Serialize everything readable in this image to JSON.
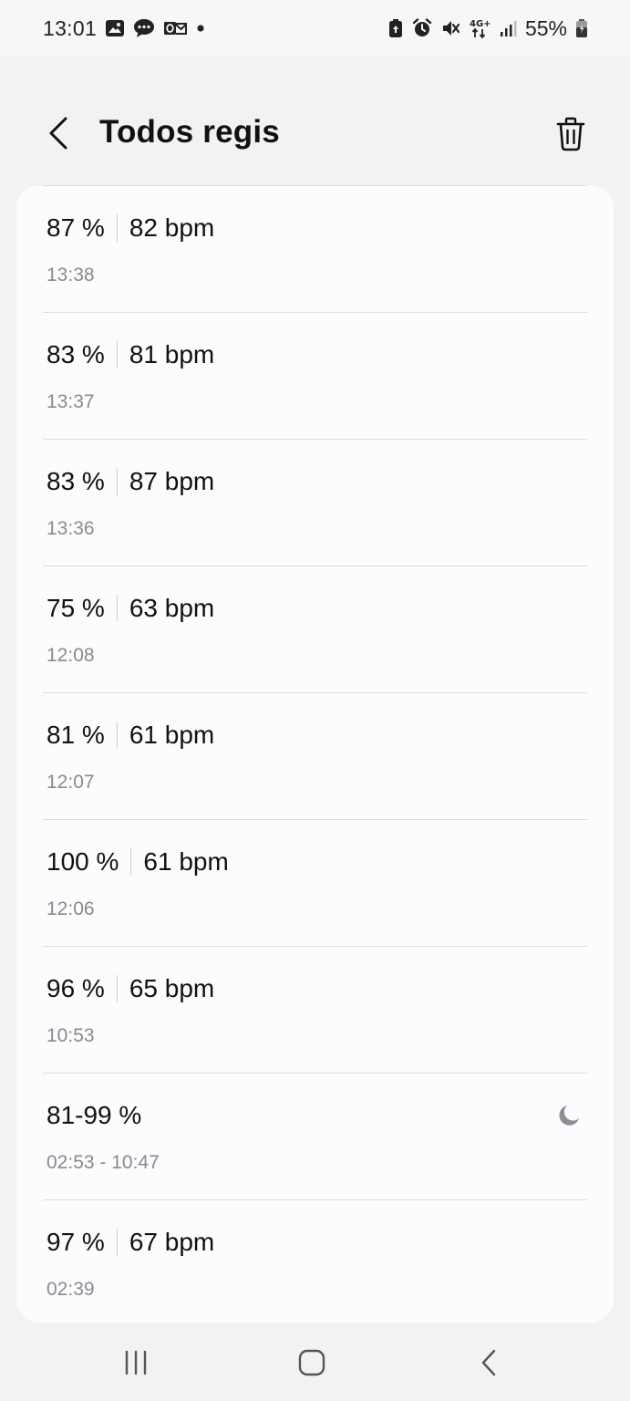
{
  "status_bar": {
    "time": "13:01",
    "battery_pct": "55%",
    "network": "4G+",
    "left_icons": [
      "gallery-icon",
      "chat-bubble-icon",
      "outlook-icon",
      "dot-icon"
    ],
    "right_icons": [
      "battery-saver-icon",
      "alarm-icon",
      "mute-icon",
      "network-4g-icon",
      "signal-icon",
      "battery-icon"
    ]
  },
  "app_bar": {
    "title": "Todos regis",
    "back_icon": "chevron-left-icon",
    "trash_icon": "trash-icon"
  },
  "records": [
    {
      "spo2": "87 %",
      "bpm": "82 bpm",
      "time": "13:38",
      "sleep": false
    },
    {
      "spo2": "83 %",
      "bpm": "81 bpm",
      "time": "13:37",
      "sleep": false
    },
    {
      "spo2": "83 %",
      "bpm": "87 bpm",
      "time": "13:36",
      "sleep": false
    },
    {
      "spo2": "75 %",
      "bpm": "63 bpm",
      "time": "12:08",
      "sleep": false
    },
    {
      "spo2": "81 %",
      "bpm": "61 bpm",
      "time": "12:07",
      "sleep": false
    },
    {
      "spo2": "100 %",
      "bpm": "61 bpm",
      "time": "12:06",
      "sleep": false
    },
    {
      "spo2": "96 %",
      "bpm": "65 bpm",
      "time": "10:53",
      "sleep": false
    },
    {
      "spo2": "81-99 %",
      "bpm": "",
      "time": "02:53 - 10:47",
      "sleep": true
    },
    {
      "spo2": "97 %",
      "bpm": "67 bpm",
      "time": "02:39",
      "sleep": false
    }
  ],
  "nav_bar": {
    "icons": [
      "recent-apps-icon",
      "home-icon",
      "back-nav-icon"
    ]
  },
  "colors": {
    "background": "#f2f2f4",
    "card": "#fcfcfe",
    "divider": "#dcdcdf",
    "secondary_text": "#8a8a8e"
  }
}
